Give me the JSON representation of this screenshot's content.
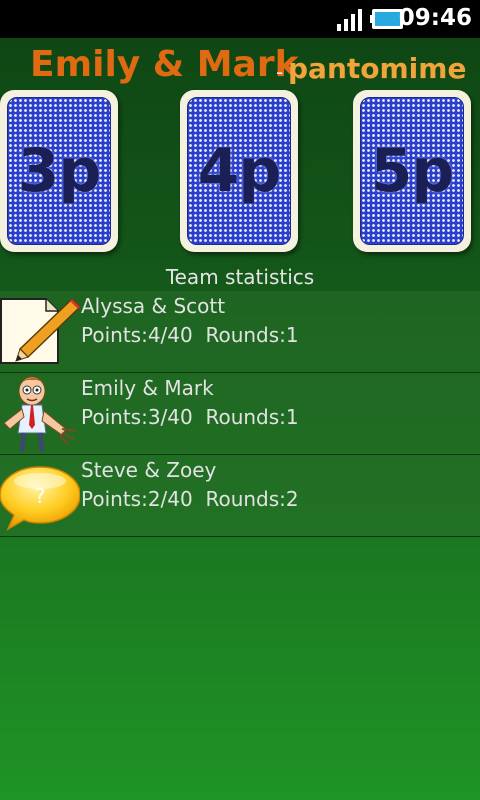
{
  "status_bar": {
    "time": "09:46",
    "icons": [
      "signal-icon",
      "battery-icon"
    ]
  },
  "header": {
    "team": "Emily & Mark",
    "separator": "-",
    "mode": "pantomime"
  },
  "cards": [
    {
      "label": "3p"
    },
    {
      "label": "4p"
    },
    {
      "label": "5p"
    }
  ],
  "section_title": "Team statistics",
  "teams": [
    {
      "name": "Alyssa & Scott",
      "points_label": "Points:",
      "points": "4/40",
      "rounds_label": "Rounds:",
      "rounds": "1",
      "icon": "pencil-paper-icon"
    },
    {
      "name": "Emily & Mark",
      "points_label": "Points:",
      "points": "3/40",
      "rounds_label": "Rounds:",
      "rounds": "1",
      "icon": "mime-person-icon"
    },
    {
      "name": "Steve & Zoey",
      "points_label": "Points:",
      "points": "2/40",
      "rounds_label": "Rounds:",
      "rounds": "2",
      "icon": "question-bubble-icon"
    }
  ],
  "colors": {
    "team_title": "#e06a12",
    "mode_title": "#f0a43a",
    "card_back": "#2b3fcf"
  }
}
